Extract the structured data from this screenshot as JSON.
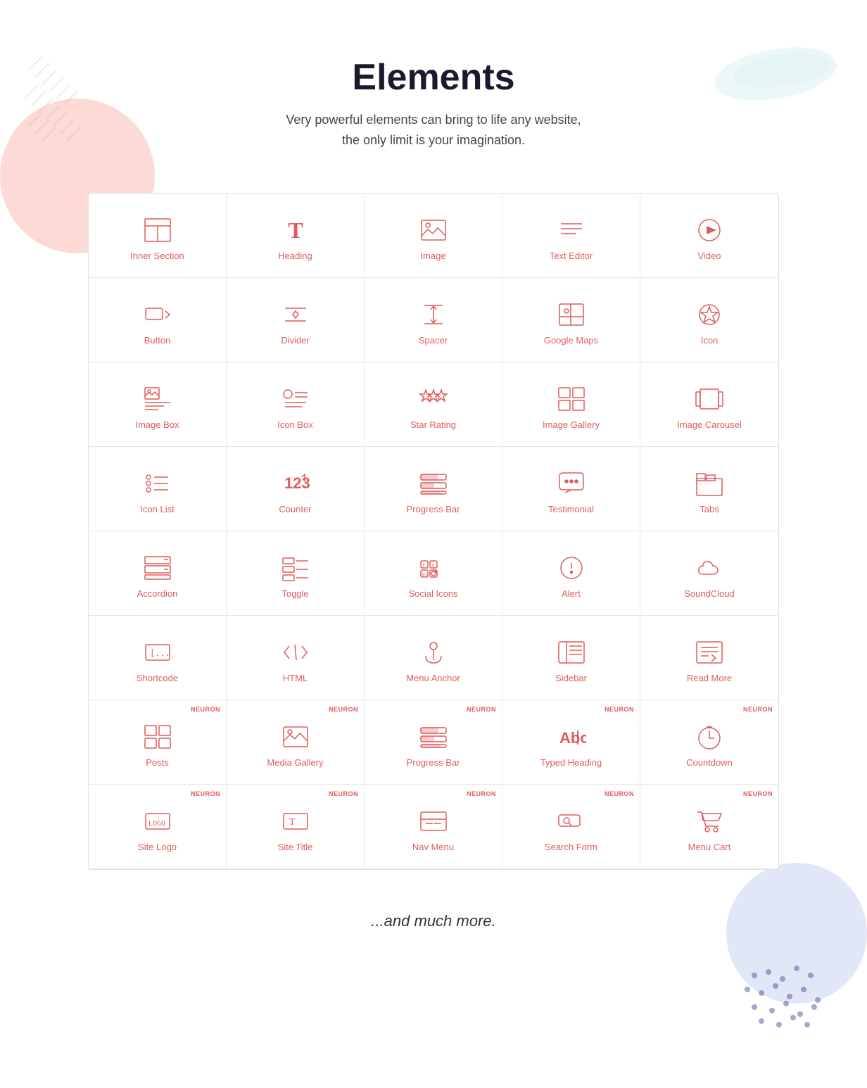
{
  "page": {
    "title": "Elements",
    "subtitle": "Very powerful elements can bring to life any website, the only limit is your imagination.",
    "footer": "...and much more."
  },
  "items": [
    {
      "id": "inner-section",
      "label": "Inner Section",
      "neuron": false,
      "icon": "inner-section"
    },
    {
      "id": "heading",
      "label": "Heading",
      "neuron": false,
      "icon": "heading"
    },
    {
      "id": "image",
      "label": "Image",
      "neuron": false,
      "icon": "image"
    },
    {
      "id": "text-editor",
      "label": "Text Editor",
      "neuron": false,
      "icon": "text-editor"
    },
    {
      "id": "video",
      "label": "Video",
      "neuron": false,
      "icon": "video"
    },
    {
      "id": "button",
      "label": "Button",
      "neuron": false,
      "icon": "button"
    },
    {
      "id": "divider",
      "label": "Divider",
      "neuron": false,
      "icon": "divider"
    },
    {
      "id": "spacer",
      "label": "Spacer",
      "neuron": false,
      "icon": "spacer"
    },
    {
      "id": "google-maps",
      "label": "Google Maps",
      "neuron": false,
      "icon": "google-maps"
    },
    {
      "id": "icon",
      "label": "Icon",
      "neuron": false,
      "icon": "icon"
    },
    {
      "id": "image-box",
      "label": "Image Box",
      "neuron": false,
      "icon": "image-box"
    },
    {
      "id": "icon-box",
      "label": "Icon Box",
      "neuron": false,
      "icon": "icon-box"
    },
    {
      "id": "star-rating",
      "label": "Star Rating",
      "neuron": false,
      "icon": "star-rating"
    },
    {
      "id": "image-gallery",
      "label": "Image Gallery",
      "neuron": false,
      "icon": "image-gallery"
    },
    {
      "id": "image-carousel",
      "label": "Image Carousel",
      "neuron": false,
      "icon": "image-carousel"
    },
    {
      "id": "icon-list",
      "label": "Icon List",
      "neuron": false,
      "icon": "icon-list"
    },
    {
      "id": "counter",
      "label": "Counter",
      "neuron": false,
      "icon": "counter"
    },
    {
      "id": "progress-bar",
      "label": "Progress Bar",
      "neuron": false,
      "icon": "progress-bar"
    },
    {
      "id": "testimonial",
      "label": "Testimonial",
      "neuron": false,
      "icon": "testimonial"
    },
    {
      "id": "tabs",
      "label": "Tabs",
      "neuron": false,
      "icon": "tabs"
    },
    {
      "id": "accordion",
      "label": "Accordion",
      "neuron": false,
      "icon": "accordion"
    },
    {
      "id": "toggle",
      "label": "Toggle",
      "neuron": false,
      "icon": "toggle"
    },
    {
      "id": "social-icons",
      "label": "Social Icons",
      "neuron": false,
      "icon": "social-icons"
    },
    {
      "id": "alert",
      "label": "Alert",
      "neuron": false,
      "icon": "alert"
    },
    {
      "id": "soundcloud",
      "label": "SoundCloud",
      "neuron": false,
      "icon": "soundcloud"
    },
    {
      "id": "shortcode",
      "label": "Shortcode",
      "neuron": false,
      "icon": "shortcode"
    },
    {
      "id": "html",
      "label": "HTML",
      "neuron": false,
      "icon": "html"
    },
    {
      "id": "menu-anchor",
      "label": "Menu Anchor",
      "neuron": false,
      "icon": "menu-anchor"
    },
    {
      "id": "sidebar",
      "label": "Sidebar",
      "neuron": false,
      "icon": "sidebar"
    },
    {
      "id": "read-more",
      "label": "Read More",
      "neuron": false,
      "icon": "read-more"
    },
    {
      "id": "posts",
      "label": "Posts",
      "neuron": true,
      "icon": "posts"
    },
    {
      "id": "media-gallery",
      "label": "Media Gallery",
      "neuron": true,
      "icon": "media-gallery"
    },
    {
      "id": "progress-bar-2",
      "label": "Progress Bar",
      "neuron": true,
      "icon": "progress-bar"
    },
    {
      "id": "typed-heading",
      "label": "Typed Heading",
      "neuron": true,
      "icon": "typed-heading"
    },
    {
      "id": "countdown",
      "label": "Countdown",
      "neuron": true,
      "icon": "countdown"
    },
    {
      "id": "site-logo",
      "label": "Site Logo",
      "neuron": true,
      "icon": "site-logo"
    },
    {
      "id": "site-title",
      "label": "Site Title",
      "neuron": true,
      "icon": "site-title"
    },
    {
      "id": "nav-menu",
      "label": "Nav Menu",
      "neuron": true,
      "icon": "nav-menu"
    },
    {
      "id": "search-form",
      "label": "Search Form",
      "neuron": true,
      "icon": "search-form"
    },
    {
      "id": "menu-cart",
      "label": "Menu Cart",
      "neuron": true,
      "icon": "menu-cart"
    }
  ]
}
